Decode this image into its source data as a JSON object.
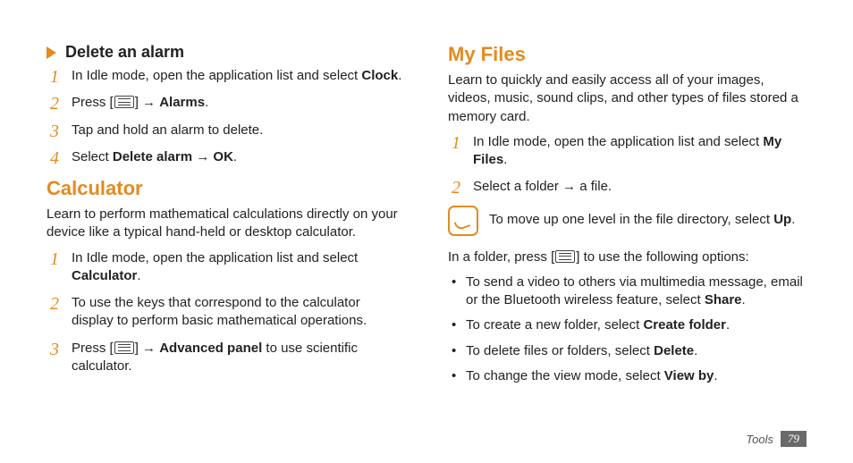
{
  "left": {
    "subhead": "Delete an alarm",
    "steps_a": {
      "s1_a": "In Idle mode, open the application list and select ",
      "s1_b": "Clock",
      "s1_c": ".",
      "s2_a": "Press [",
      "s2_b": "] → ",
      "s2_c": "Alarms",
      "s2_d": ".",
      "s3": "Tap and hold an alarm to delete.",
      "s4_a": "Select ",
      "s4_b": "Delete alarm",
      "s4_c": " → ",
      "s4_d": "OK",
      "s4_e": "."
    },
    "calc_title": "Calculator",
    "calc_intro": "Learn to perform mathematical calculations directly on your device like a typical hand-held or desktop calculator.",
    "steps_b": {
      "s1_a": "In Idle mode, open the application list and select ",
      "s1_b": "Calculator",
      "s1_c": ".",
      "s2": "To use the keys that correspond to the calculator display to perform basic mathematical operations.",
      "s3_a": "Press [",
      "s3_b": "] → ",
      "s3_c": "Advanced panel",
      "s3_d": " to use scientific calculator."
    }
  },
  "right": {
    "title": "My Files",
    "intro": "Learn to quickly and easily access all of your images, videos, music, sound clips, and other types of files stored a memory card.",
    "steps": {
      "s1_a": "In Idle mode, open the application list and select ",
      "s1_b": "My Files",
      "s1_c": ".",
      "s2": "Select a folder → a file."
    },
    "note_a": "To move up one level in the file directory, select ",
    "note_b": "Up",
    "note_c": ".",
    "folder_a": "In a folder, press [",
    "folder_b": "] to use the following options:",
    "bul": {
      "b1_a": "To send a video to others via multimedia message, email or the Bluetooth wireless feature, select ",
      "b1_b": "Share",
      "b1_c": ".",
      "b2_a": "To create a new folder, select ",
      "b2_b": "Create folder",
      "b2_c": ".",
      "b3_a": "To delete files or folders, select ",
      "b3_b": "Delete",
      "b3_c": ".",
      "b4_a": "To change the view mode, select ",
      "b4_b": "View by",
      "b4_c": "."
    }
  },
  "footer": {
    "category": "Tools",
    "page": "79"
  }
}
